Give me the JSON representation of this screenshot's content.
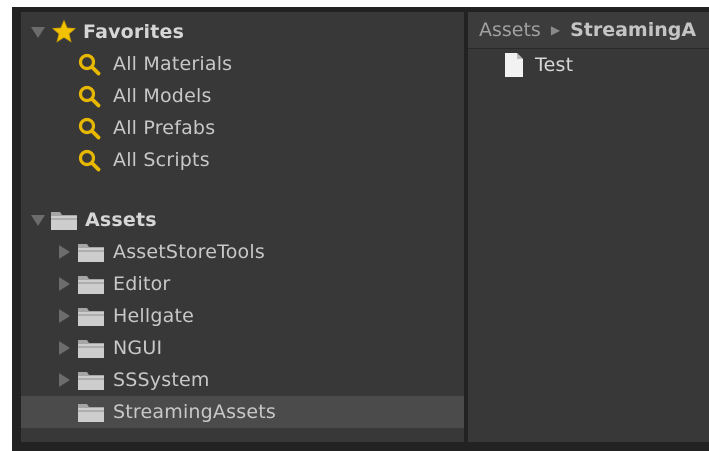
{
  "favorites": {
    "title": "Favorites",
    "items": [
      {
        "label": "All Materials",
        "icon": "search-icon"
      },
      {
        "label": "All Models",
        "icon": "search-icon"
      },
      {
        "label": "All Prefabs",
        "icon": "search-icon"
      },
      {
        "label": "All Scripts",
        "icon": "search-icon"
      }
    ]
  },
  "assets": {
    "title": "Assets",
    "folders": [
      {
        "label": "AssetStoreTools",
        "expandable": true
      },
      {
        "label": "Editor",
        "expandable": true
      },
      {
        "label": "Hellgate",
        "expandable": true
      },
      {
        "label": "NGUI",
        "expandable": true
      },
      {
        "label": "SSSystem",
        "expandable": true
      },
      {
        "label": "StreamingAssets",
        "expandable": false,
        "selected": true
      }
    ]
  },
  "breadcrumb": {
    "items": [
      "Assets",
      "StreamingA"
    ],
    "separator": "▶"
  },
  "files": [
    {
      "label": "Test",
      "icon": "file-icon"
    }
  ],
  "colors": {
    "background": "#383838",
    "selected_row": "#4b4b4b",
    "text": "#c8c8c8",
    "search_icon": "#e8b800",
    "star_icon": "#f2c200"
  }
}
